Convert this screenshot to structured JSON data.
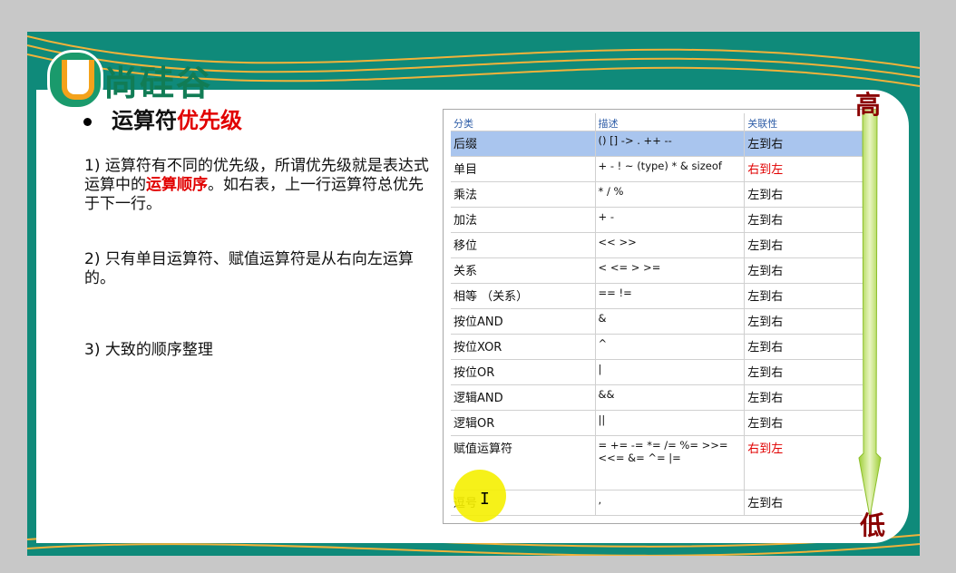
{
  "logo": {
    "text": "尚硅谷"
  },
  "slide": {
    "title_prefix": "运算符",
    "title_highlight": "优先级",
    "p1_a": "1) 运算符有不同的优先级，所谓优先级就是表达式运算中的",
    "p1_red": "运算顺序",
    "p1_b": "。如右表，上一行运算符总优先于下一行。",
    "p2": "2) 只有单目运算符、赋值运算符是从右向左运算的。",
    "p3": "3) 大致的顺序整理"
  },
  "table": {
    "headers": [
      "分类",
      "描述",
      "关联性"
    ],
    "rows": [
      {
        "cat": "后缀",
        "desc": "() [] -> . ++ --",
        "assoc": "左到右"
      },
      {
        "cat": "单目",
        "desc": "+ - ! ~ (type) * & sizeof",
        "assoc": "右到左"
      },
      {
        "cat": "乘法",
        "desc": "* / %",
        "assoc": "左到右"
      },
      {
        "cat": "加法",
        "desc": "+ -",
        "assoc": "左到右"
      },
      {
        "cat": "移位",
        "desc": "<< >>",
        "assoc": "左到右"
      },
      {
        "cat": "关系",
        "desc": "< <= > >=",
        "assoc": "左到右"
      },
      {
        "cat": "相等 （关系）",
        "desc": "== !=",
        "assoc": "左到右"
      },
      {
        "cat": "按位AND",
        "desc": "&",
        "assoc": "左到右"
      },
      {
        "cat": "按位XOR",
        "desc": "^",
        "assoc": "左到右"
      },
      {
        "cat": "按位OR",
        "desc": "|",
        "assoc": "左到右"
      },
      {
        "cat": "逻辑AND",
        "desc": "&&",
        "assoc": "左到右"
      },
      {
        "cat": "逻辑OR",
        "desc": "||",
        "assoc": "左到右"
      },
      {
        "cat": "赋值运算符",
        "desc": "= += -= *= /= %= >>= <<= &= ^= |=",
        "assoc": "右到左"
      },
      {
        "cat": "逗号",
        "desc": ",",
        "assoc": "左到右"
      }
    ]
  },
  "scale": {
    "high": "高",
    "low": "低"
  },
  "colors": {
    "teal": "#0f8a7a",
    "red": "#e10000",
    "selected": "#a9c5ee"
  }
}
